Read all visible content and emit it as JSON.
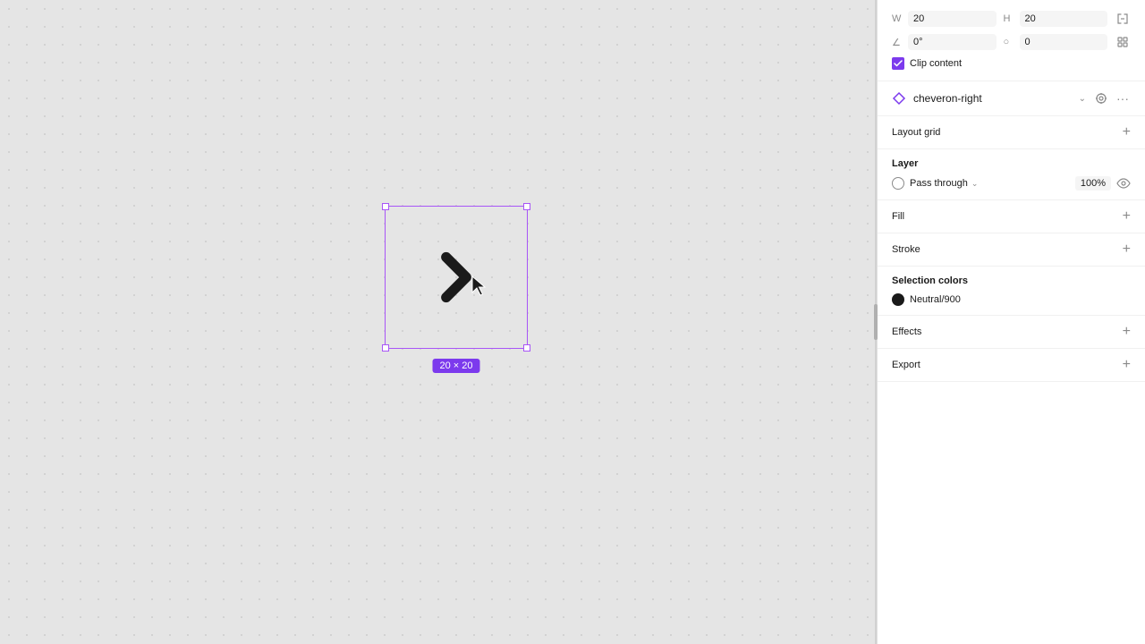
{
  "canvas": {
    "background": "#e5e5e5"
  },
  "element": {
    "width": 20,
    "height": 20,
    "size_label": "20 × 20",
    "name": "cheveron-right"
  },
  "properties": {
    "w_label": "W",
    "h_label": "H",
    "w_value": "20",
    "h_value": "20",
    "angle_label": "°",
    "angle_value": "0°",
    "corner_radius_value": "0",
    "clip_content_label": "Clip content",
    "component_name": "cheveron-right",
    "layout_grid_label": "Layout grid",
    "layer_label": "Layer",
    "blend_mode": "Pass through",
    "opacity": "100%",
    "fill_label": "Fill",
    "stroke_label": "Stroke",
    "selection_colors_label": "Selection colors",
    "color_name": "Neutral/900",
    "effects_label": "Effects",
    "export_label": "Export"
  },
  "icons": {
    "add": "+",
    "chevron_down": "⌄",
    "more": "···",
    "component": "◇",
    "eye": "👁",
    "lock": "🔒",
    "resize": "⤢",
    "corner": "⌐"
  }
}
